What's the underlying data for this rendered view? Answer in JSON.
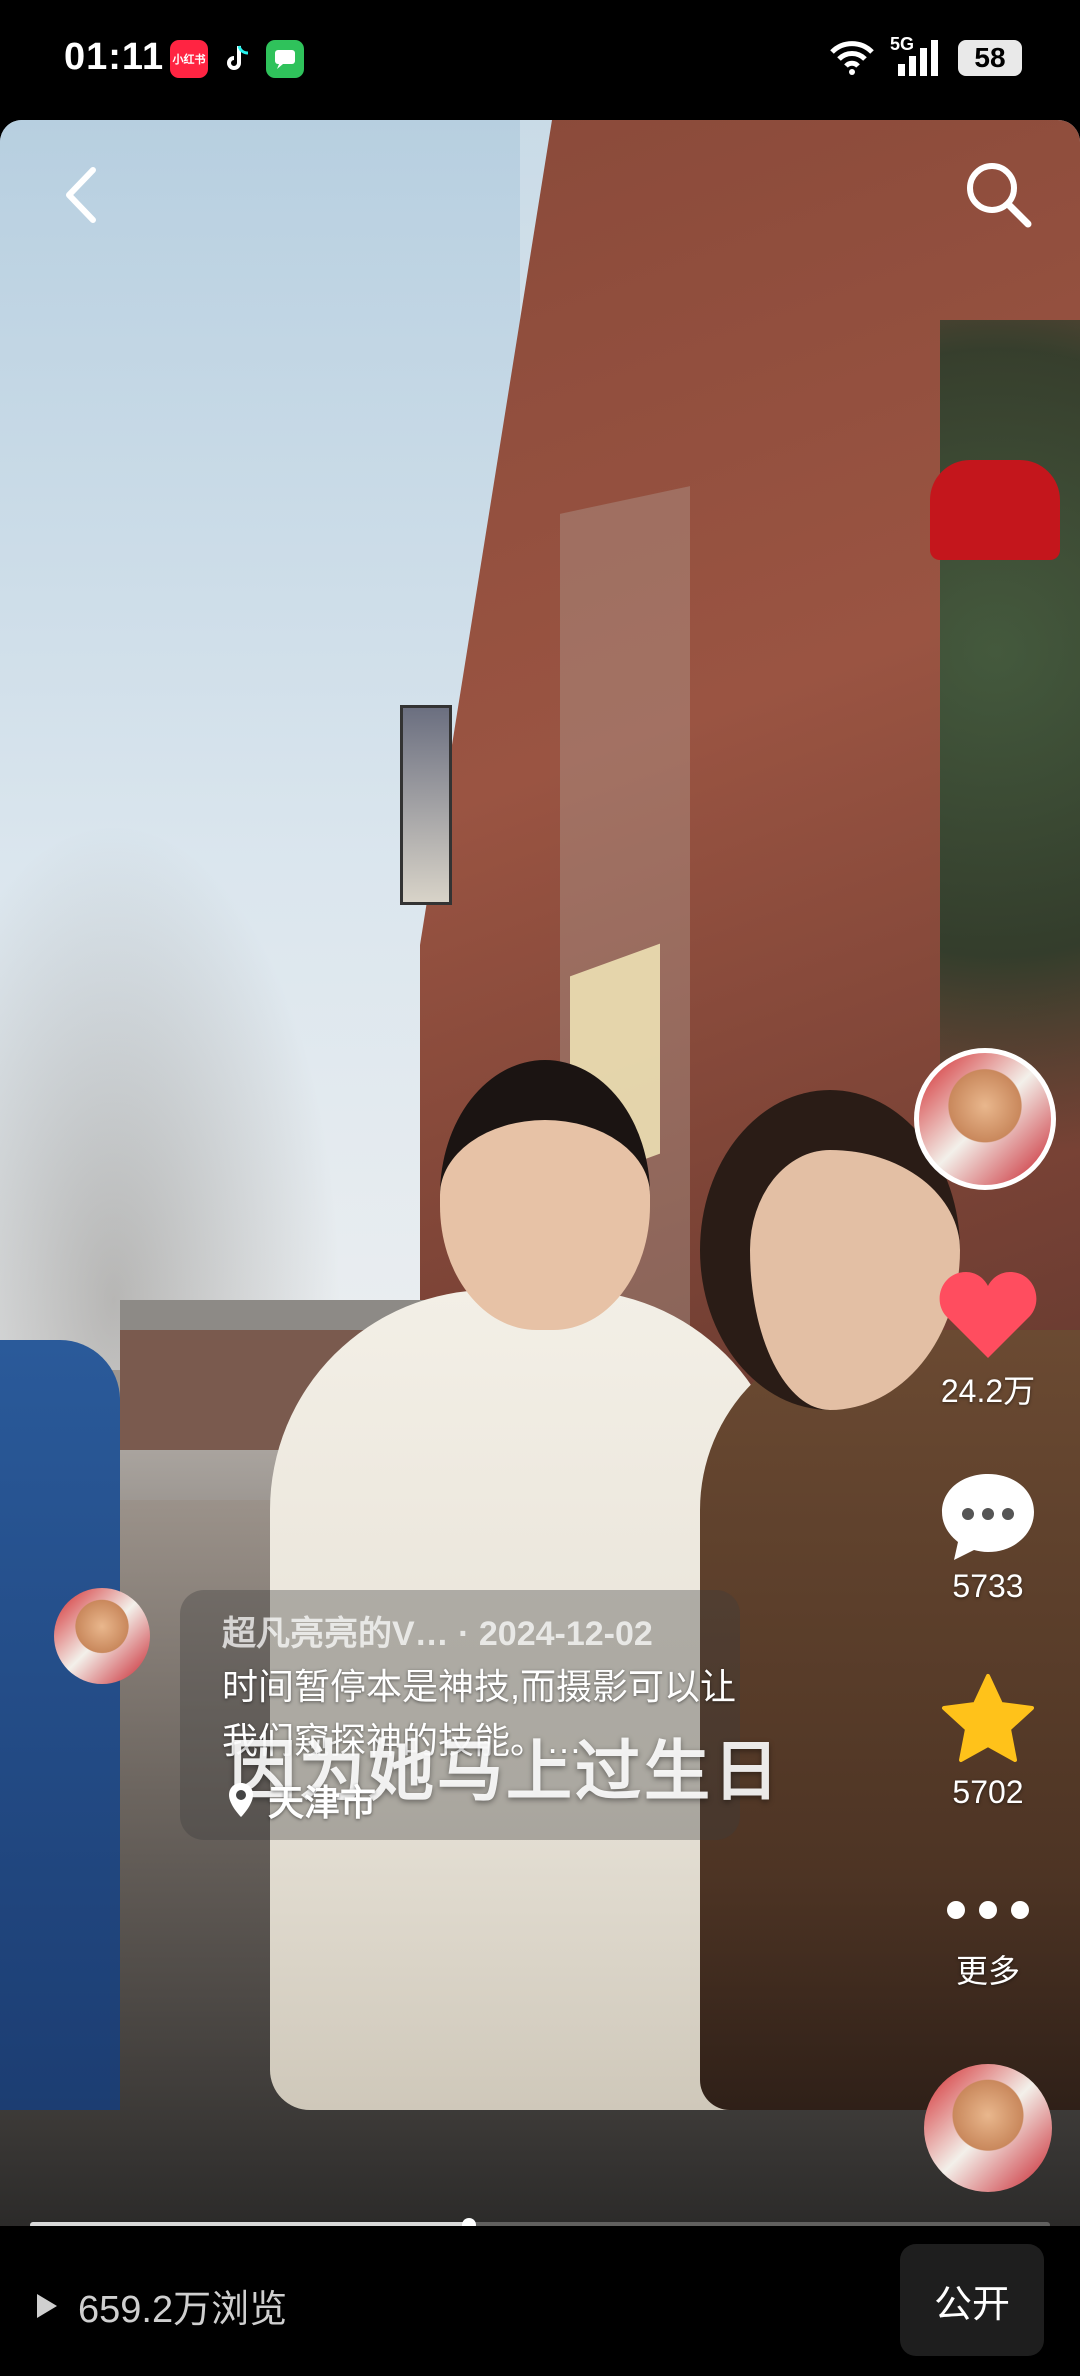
{
  "status_bar": {
    "time": "01:11",
    "app_badges": [
      "小红书",
      "tiktok-icon",
      "messages-icon"
    ],
    "network": "5G",
    "battery": "58"
  },
  "nav": {
    "back_icon": "chevron-left-icon",
    "search_icon": "search-icon"
  },
  "video": {
    "overlay_caption": "因为她马上过生日"
  },
  "post": {
    "meta": "超凡亮亮的V… · 2024-12-02",
    "description": "时间暂停本是神技,而摄影可以让我们窥探神的技能。…",
    "location": "天津市"
  },
  "actions": {
    "likes": "24.2万",
    "comments": "5733",
    "favorites": "5702",
    "more": "更多"
  },
  "playback": {
    "progress": 0.43
  },
  "footer": {
    "views": "659.2万浏览",
    "public_label": "公开"
  },
  "colors": {
    "like": "#ff4d5f",
    "star": "#ffc21a",
    "background": "#000000"
  }
}
